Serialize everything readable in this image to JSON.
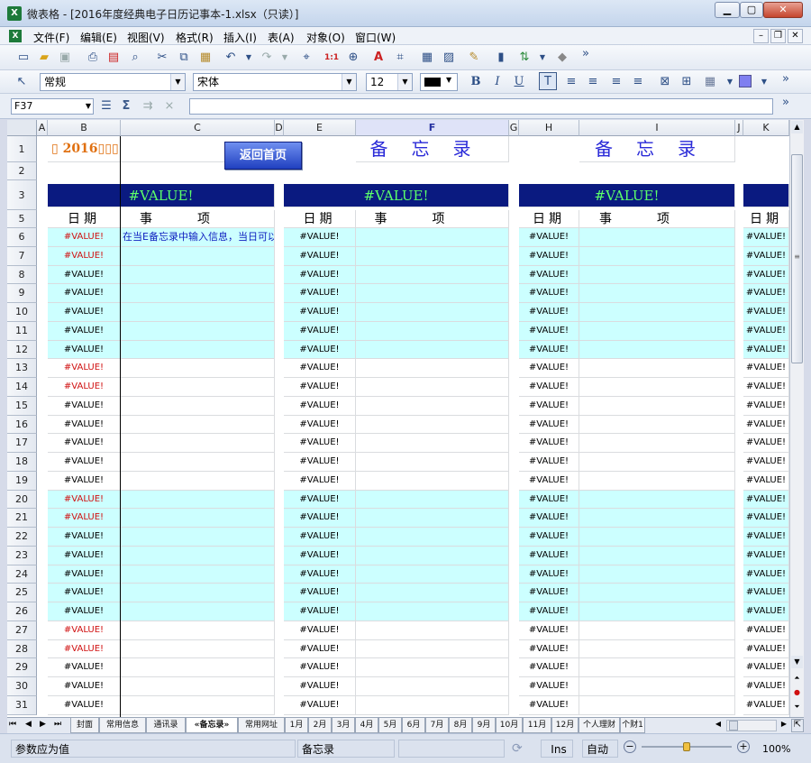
{
  "window": {
    "title": "微表格 - [2016年度经典电子日历记事本-1.xlsx（只读）]",
    "app_icon": "X"
  },
  "menu": [
    "文件(F)",
    "编辑(E)",
    "视图(V)",
    "格式(R)",
    "插入(I)",
    "表(A)",
    "对象(O)",
    "窗口(W)"
  ],
  "toolbar2": {
    "style": "常规",
    "font": "宋体",
    "size": "12"
  },
  "formula": {
    "name_box": "F37",
    "value": ""
  },
  "columns": [
    "A",
    "B",
    "C",
    "D",
    "E",
    "F",
    "G",
    "H",
    "I",
    "J",
    "K"
  ],
  "sheet": {
    "logo_text": "▯ 2016▯▯▯",
    "back_button": "返回首页",
    "memo_title": "备忘录",
    "value_error": "#VALUE!",
    "date_header": "日期",
    "item_header": "事项",
    "hint_text": "在当E备忘录中输入信息，当日可以",
    "rows": [
      "1",
      "2",
      "3",
      "5",
      "6",
      "7",
      "8",
      "9",
      "10",
      "11",
      "12",
      "13",
      "14",
      "15",
      "16",
      "17",
      "18",
      "19",
      "20",
      "21",
      "22",
      "23",
      "24",
      "25",
      "26",
      "27",
      "28",
      "29",
      "30",
      "31"
    ]
  },
  "sheet_tabs": [
    "封面",
    "常用信息",
    "通讯录",
    "«备忘录»",
    "常用网址",
    "1月",
    "2月",
    "3月",
    "4月",
    "5月",
    "6月",
    "7月",
    "8月",
    "9月",
    "10月",
    "11月",
    "12月",
    "个人理财",
    "个财1"
  ],
  "status": {
    "message": "参数应为值",
    "sheet_name": "备忘录",
    "ins": "Ins",
    "mode": "自动",
    "zoom": "100%"
  }
}
